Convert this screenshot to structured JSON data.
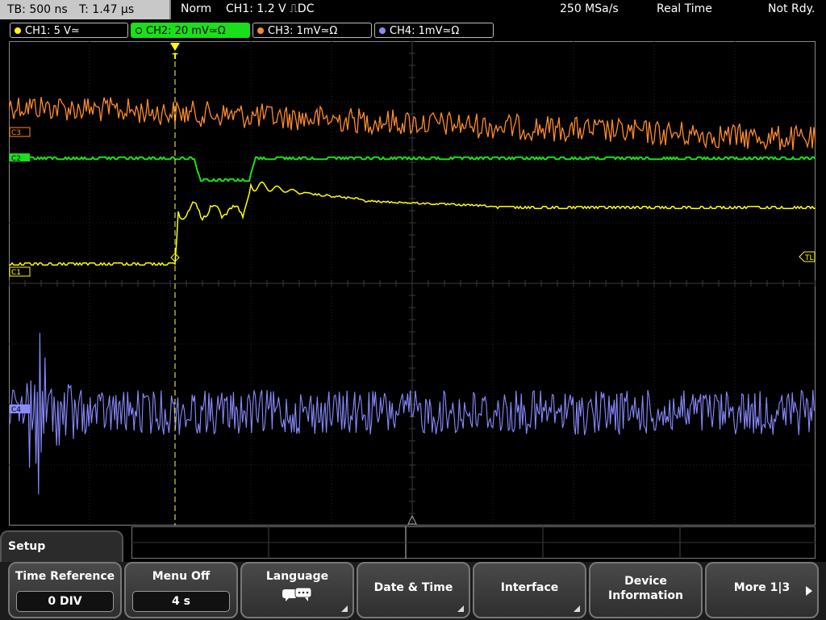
{
  "topbar": {
    "tb_label": "TB: 500 ns",
    "t_label": "T: 1.47 µs",
    "mode": "Norm",
    "trigger": "CH1: 1.2 V ⎍DC",
    "sample_rate": "250 MSa/s",
    "acq_mode": "Real Time",
    "status": "Not Rdy."
  },
  "channels": [
    {
      "label": "CH1: 5 V≃",
      "color": "#ffff00"
    },
    {
      "label": "CH2: 20 mV≃Ω",
      "color": "#19e019"
    },
    {
      "label": "CH3: 1mV≃Ω",
      "color": "#ff8c2a"
    },
    {
      "label": "CH4: 1mV≃Ω",
      "color": "#8a8aff"
    }
  ],
  "markers": {
    "c3": "C3",
    "c2": "C2",
    "c1": "C1",
    "c4": "C4",
    "tl": "TL",
    "trigger": "T"
  },
  "menu": {
    "title": "Setup",
    "time_reference_label": "Time Reference",
    "time_reference_value": "0 DIV",
    "menu_off_label": "Menu Off",
    "menu_off_value": "4 s",
    "language_label": "Language",
    "date_time_label": "Date & Time",
    "interface_label": "Interface",
    "device_info_label": "Device",
    "device_info_label2": "Information",
    "more_label": "More 1|3"
  }
}
